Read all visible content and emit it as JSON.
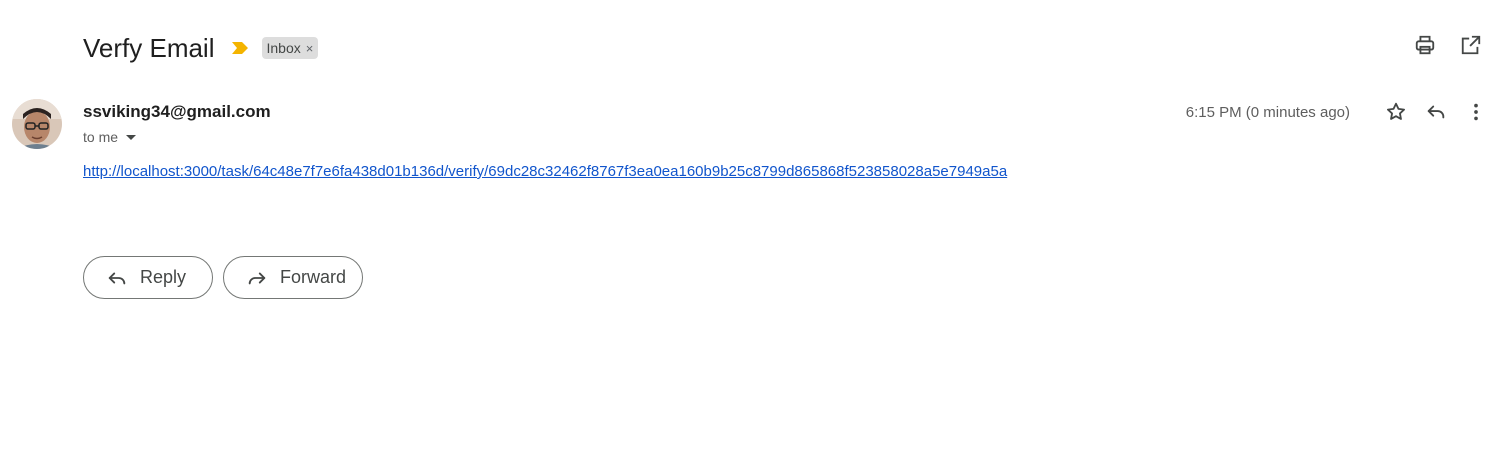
{
  "message": {
    "subject": "Verfy Email",
    "label": "Inbox",
    "label_remove": "×",
    "sender_email": "ssviking34@gmail.com",
    "recipient": "to me",
    "timestamp": "6:15 PM (0 minutes ago)",
    "body_link": "http://localhost:3000/task/64c48e7f7e6fa438d01b136d/verify/69dc28c32462f8767f3ea0ea160b9b25c8799d865868f523858028a5e7949a5a"
  },
  "actions": {
    "reply_label": "Reply",
    "forward_label": "Forward"
  },
  "icons": {
    "importance": "importance-marker-icon",
    "print": "print-icon",
    "open_new_window": "open-in-new-window-icon",
    "star": "star-icon",
    "reply": "reply-icon",
    "more": "more-vert-icon",
    "forward": "forward-icon"
  },
  "colors": {
    "importance_marker": "#f4b400",
    "link": "#1155cc",
    "label_chip_bg": "#dddddd"
  }
}
